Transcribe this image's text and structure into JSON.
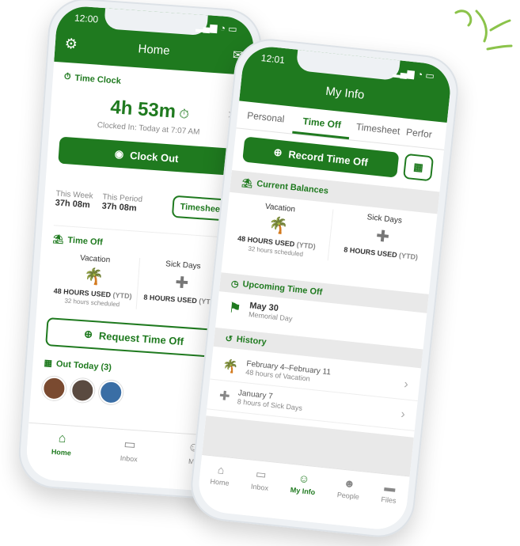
{
  "home": {
    "time": "12:00",
    "title": "Home",
    "time_clock_label": "Time Clock",
    "clock_value": "4h 53m",
    "clocked_in": "Clocked In: Today at 7:07 AM",
    "clock_out_label": "Clock Out",
    "this_week_label": "This Week",
    "this_week_value": "37h 08m",
    "this_period_label": "This Period",
    "this_period_value": "37h 08m",
    "timesheet_button": "Timesheet",
    "time_off_label": "Time Off",
    "vacation_label": "Vacation",
    "vacation_used": "48 HOURS USED",
    "vacation_ytd": "(YTD)",
    "vacation_scheduled": "32 hours scheduled",
    "sick_label": "Sick Days",
    "sick_used": "8 HOURS USED",
    "sick_ytd": "(YTD)",
    "request_label": "Request Time Off",
    "out_today_label": "Out Today (3)",
    "tabs": [
      "Home",
      "Inbox",
      "My"
    ]
  },
  "myinfo": {
    "time": "12:01",
    "title": "My Info",
    "tabs": [
      "Personal",
      "Time Off",
      "Timesheet",
      "Perfor"
    ],
    "record_label": "Record Time Off",
    "balances_label": "Current Balances",
    "vacation_label": "Vacation",
    "vacation_used": "48 HOURS USED",
    "vacation_ytd": "(YTD)",
    "vacation_scheduled": "32 hours scheduled",
    "sick_label": "Sick Days",
    "sick_used": "8 HOURS USED",
    "sick_ytd": "(YTD)",
    "upcoming_label": "Upcoming Time Off",
    "upcoming_date": "May 30",
    "upcoming_name": "Memorial Day",
    "history_label": "History",
    "history": [
      {
        "title": "February 4–February 11",
        "sub": "48 hours of Vacation"
      },
      {
        "title": "January 7",
        "sub": "8 hours of Sick Days"
      }
    ],
    "bottom_tabs": [
      "Home",
      "Inbox",
      "My Info",
      "People",
      "Files"
    ]
  },
  "colors": {
    "brand": "#1f7a1f",
    "accent_doodle": "#8bc34a"
  }
}
